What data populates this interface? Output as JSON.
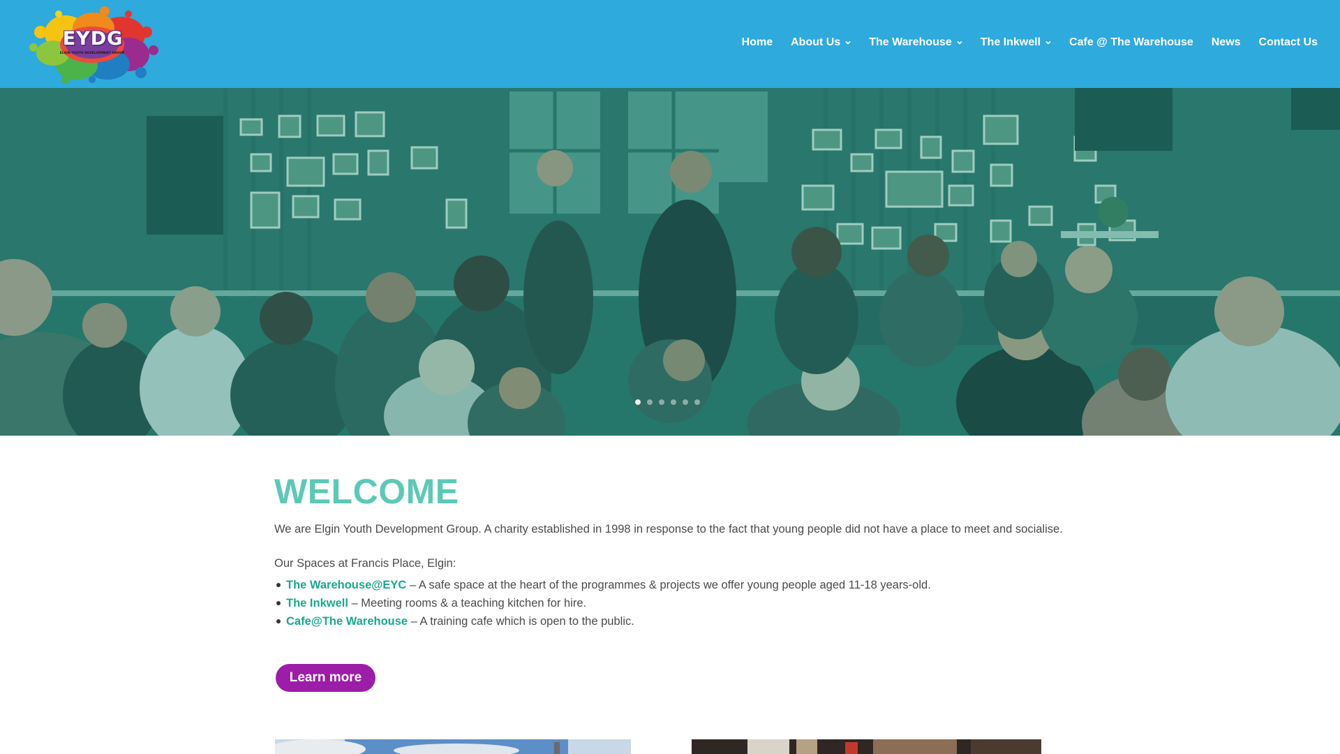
{
  "header": {
    "logo_text": "EYDG",
    "logo_subtitle": "ELGIN YOUTH DEVELOPMENT GROUP",
    "nav": [
      {
        "label": "Home",
        "has_dropdown": false
      },
      {
        "label": "About Us",
        "has_dropdown": true
      },
      {
        "label": "The Warehouse",
        "has_dropdown": true
      },
      {
        "label": "The Inkwell",
        "has_dropdown": true
      },
      {
        "label": "Cafe @ The Warehouse",
        "has_dropdown": false
      },
      {
        "label": "News",
        "has_dropdown": false
      },
      {
        "label": "Contact Us",
        "has_dropdown": false
      }
    ]
  },
  "hero": {
    "slide_count": 6,
    "active_slide": 1
  },
  "main": {
    "heading": "WELCOME",
    "intro": "We are Elgin Youth Development Group. A charity established in 1998 in response to the fact that young people did not have a place to meet and socialise.",
    "spaces_title": "Our Spaces at Francis Place, Elgin:",
    "spaces": [
      {
        "link": "The Warehouse@EYC",
        "desc": " – A safe space at the heart of the programmes & projects we offer young people aged 11-18 years-old."
      },
      {
        "link": "The Inkwell",
        "desc": " – Meeting rooms & a teaching kitchen for hire."
      },
      {
        "link": "Cafe@The Warehouse",
        "desc": " – A training cafe which is open to the public."
      }
    ],
    "button_label": "Learn more"
  },
  "colors": {
    "header_bg": "#2eaadc",
    "heading": "#5cc9b6",
    "link": "#17a88f",
    "button": "#9b1da8",
    "hero_overlay": "#2c6e62"
  }
}
